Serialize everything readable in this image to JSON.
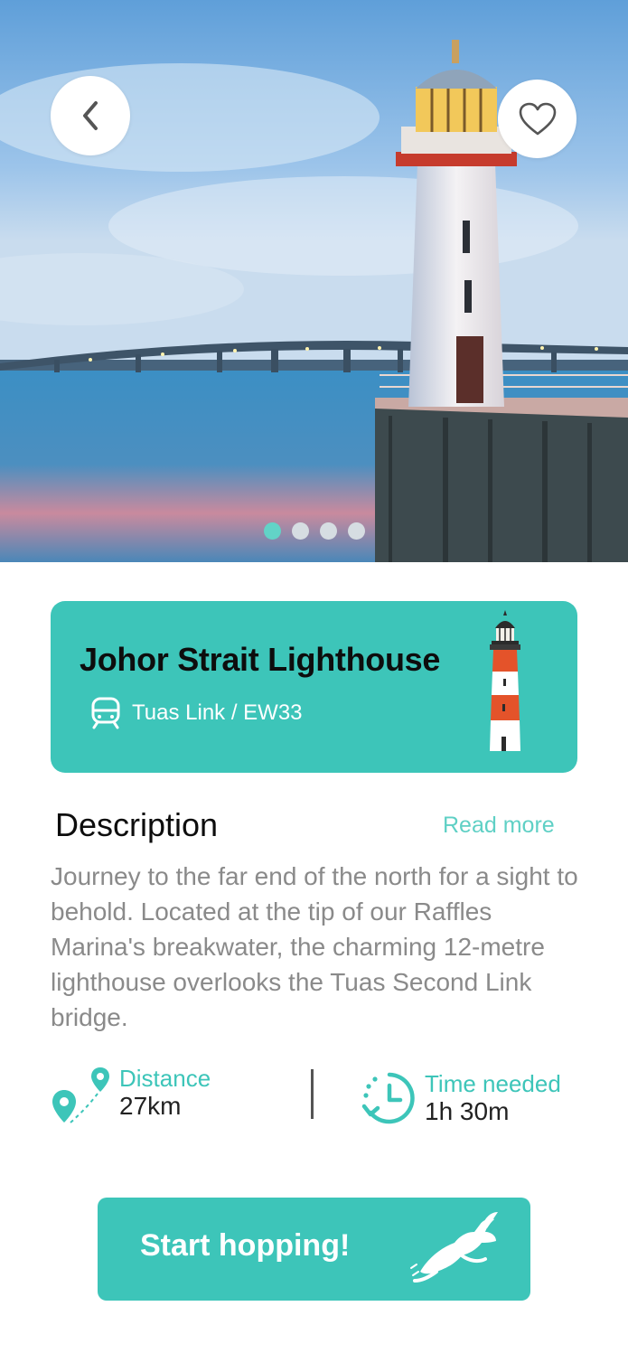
{
  "hero": {
    "image_description_icon": "lighthouse-photo",
    "carousel": {
      "count": 4,
      "active_index": 0
    }
  },
  "toolbar": {
    "back_icon": "chevron-left-icon",
    "favorite_icon": "heart-outline-icon"
  },
  "place": {
    "name": "Johor Strait Lighthouse",
    "station": "Tuas Link / EW33",
    "station_icon": "train-icon",
    "illustration_icon": "lighthouse-icon"
  },
  "description": {
    "heading": "Description",
    "read_more": "Read more",
    "body": "Journey to the far end of the north for a sight to behold. Located at the tip of our Raffles Marina's breakwater, the charming 12-metre lighthouse overlooks the Tuas Second Link bridge."
  },
  "stats": {
    "distance": {
      "label": "Distance",
      "value": "27km",
      "icon": "route-pin-icon"
    },
    "time": {
      "label": "Time needed",
      "value": "1h 30m",
      "icon": "clock-history-icon"
    }
  },
  "cta": {
    "label": "Start hopping!",
    "icon": "rabbit-icon"
  },
  "colors": {
    "accent": "#3dc5b9",
    "accent_light": "#5fd0c5",
    "text_muted": "#8a8a8a"
  }
}
